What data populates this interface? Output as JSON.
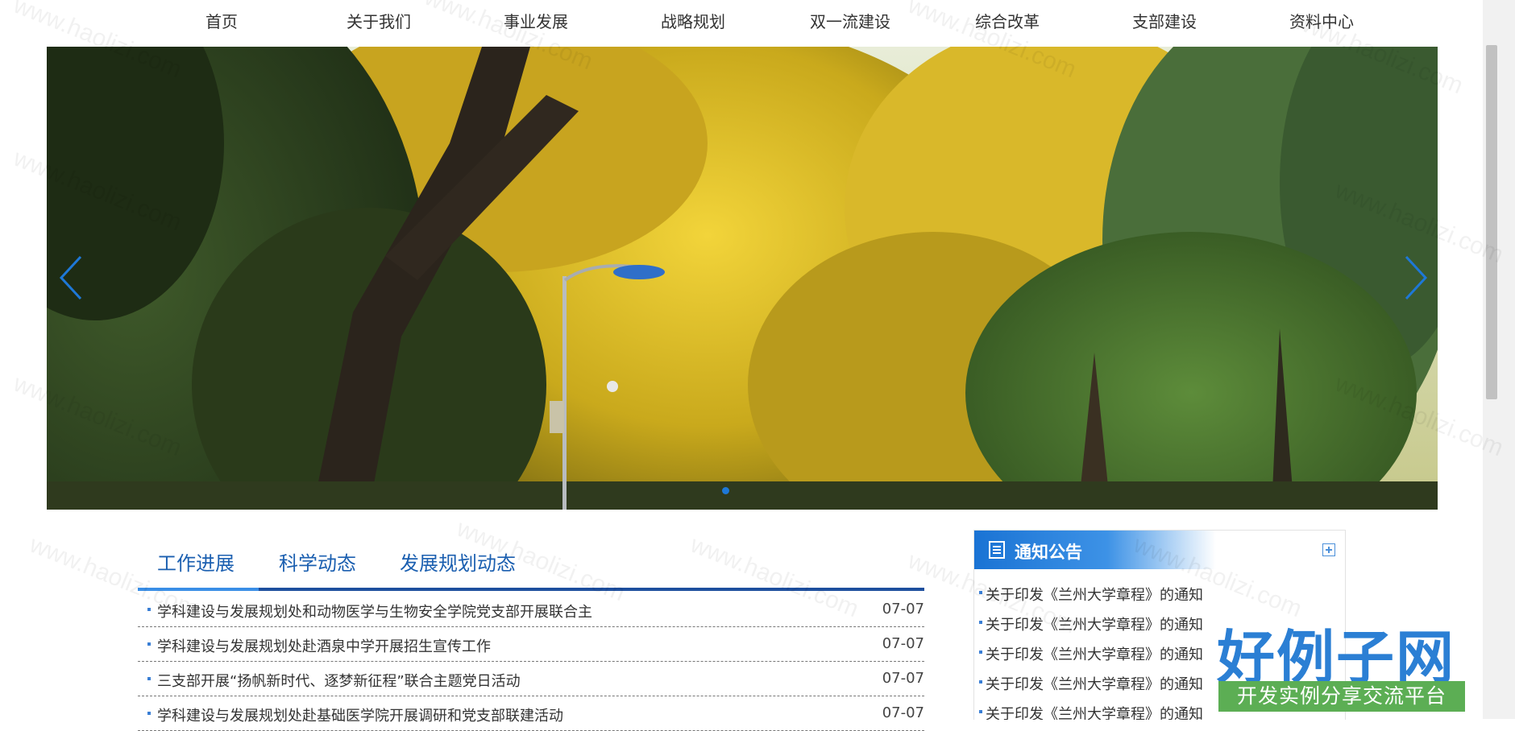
{
  "nav": {
    "items": [
      "首页",
      "关于我们",
      "事业发展",
      "战略规划",
      "双一流建设",
      "综合改革",
      "支部建设",
      "资料中心"
    ]
  },
  "banner": {
    "prev_icon": "chevron-left-icon",
    "next_icon": "chevron-right-icon",
    "accent": "#1e78d7"
  },
  "news": {
    "tabs": [
      "工作进展",
      "科学动态",
      "发展规划动态"
    ],
    "active_tab": 0,
    "items": [
      {
        "title": "学科建设与发展规划处和动物医学与生物安全学院党支部开展联合主",
        "date": "07-07"
      },
      {
        "title": "学科建设与发展规划处赴酒泉中学开展招生宣传工作",
        "date": "07-07"
      },
      {
        "title": "三支部开展“扬帆新时代、逐梦新征程”联合主题党日活动",
        "date": "07-07"
      },
      {
        "title": "学科建设与发展规划处赴基础医学院开展调研和党支部联建活动",
        "date": "07-07"
      }
    ]
  },
  "notice": {
    "title": "通知公告",
    "icon": "list-document-icon",
    "more_icon": "plus-box-icon",
    "items": [
      "关于印发《兰州大学章程》的通知",
      "关于印发《兰州大学章程》的通知",
      "关于印发《兰州大学章程》的通知",
      "关于印发《兰州大学章程》的通知",
      "关于印发《兰州大学章程》的通知"
    ]
  },
  "watermark": "www.haolizi.com",
  "logo": {
    "main": "好例子网",
    "sub": "开发实例分享交流平台",
    "main_color": "#2b7fd4",
    "sub_color": "#5cae54"
  },
  "colors": {
    "primary": "#1b5fb0",
    "tab_line": "#1e4f9e",
    "notice_head": "#1a73d4"
  }
}
